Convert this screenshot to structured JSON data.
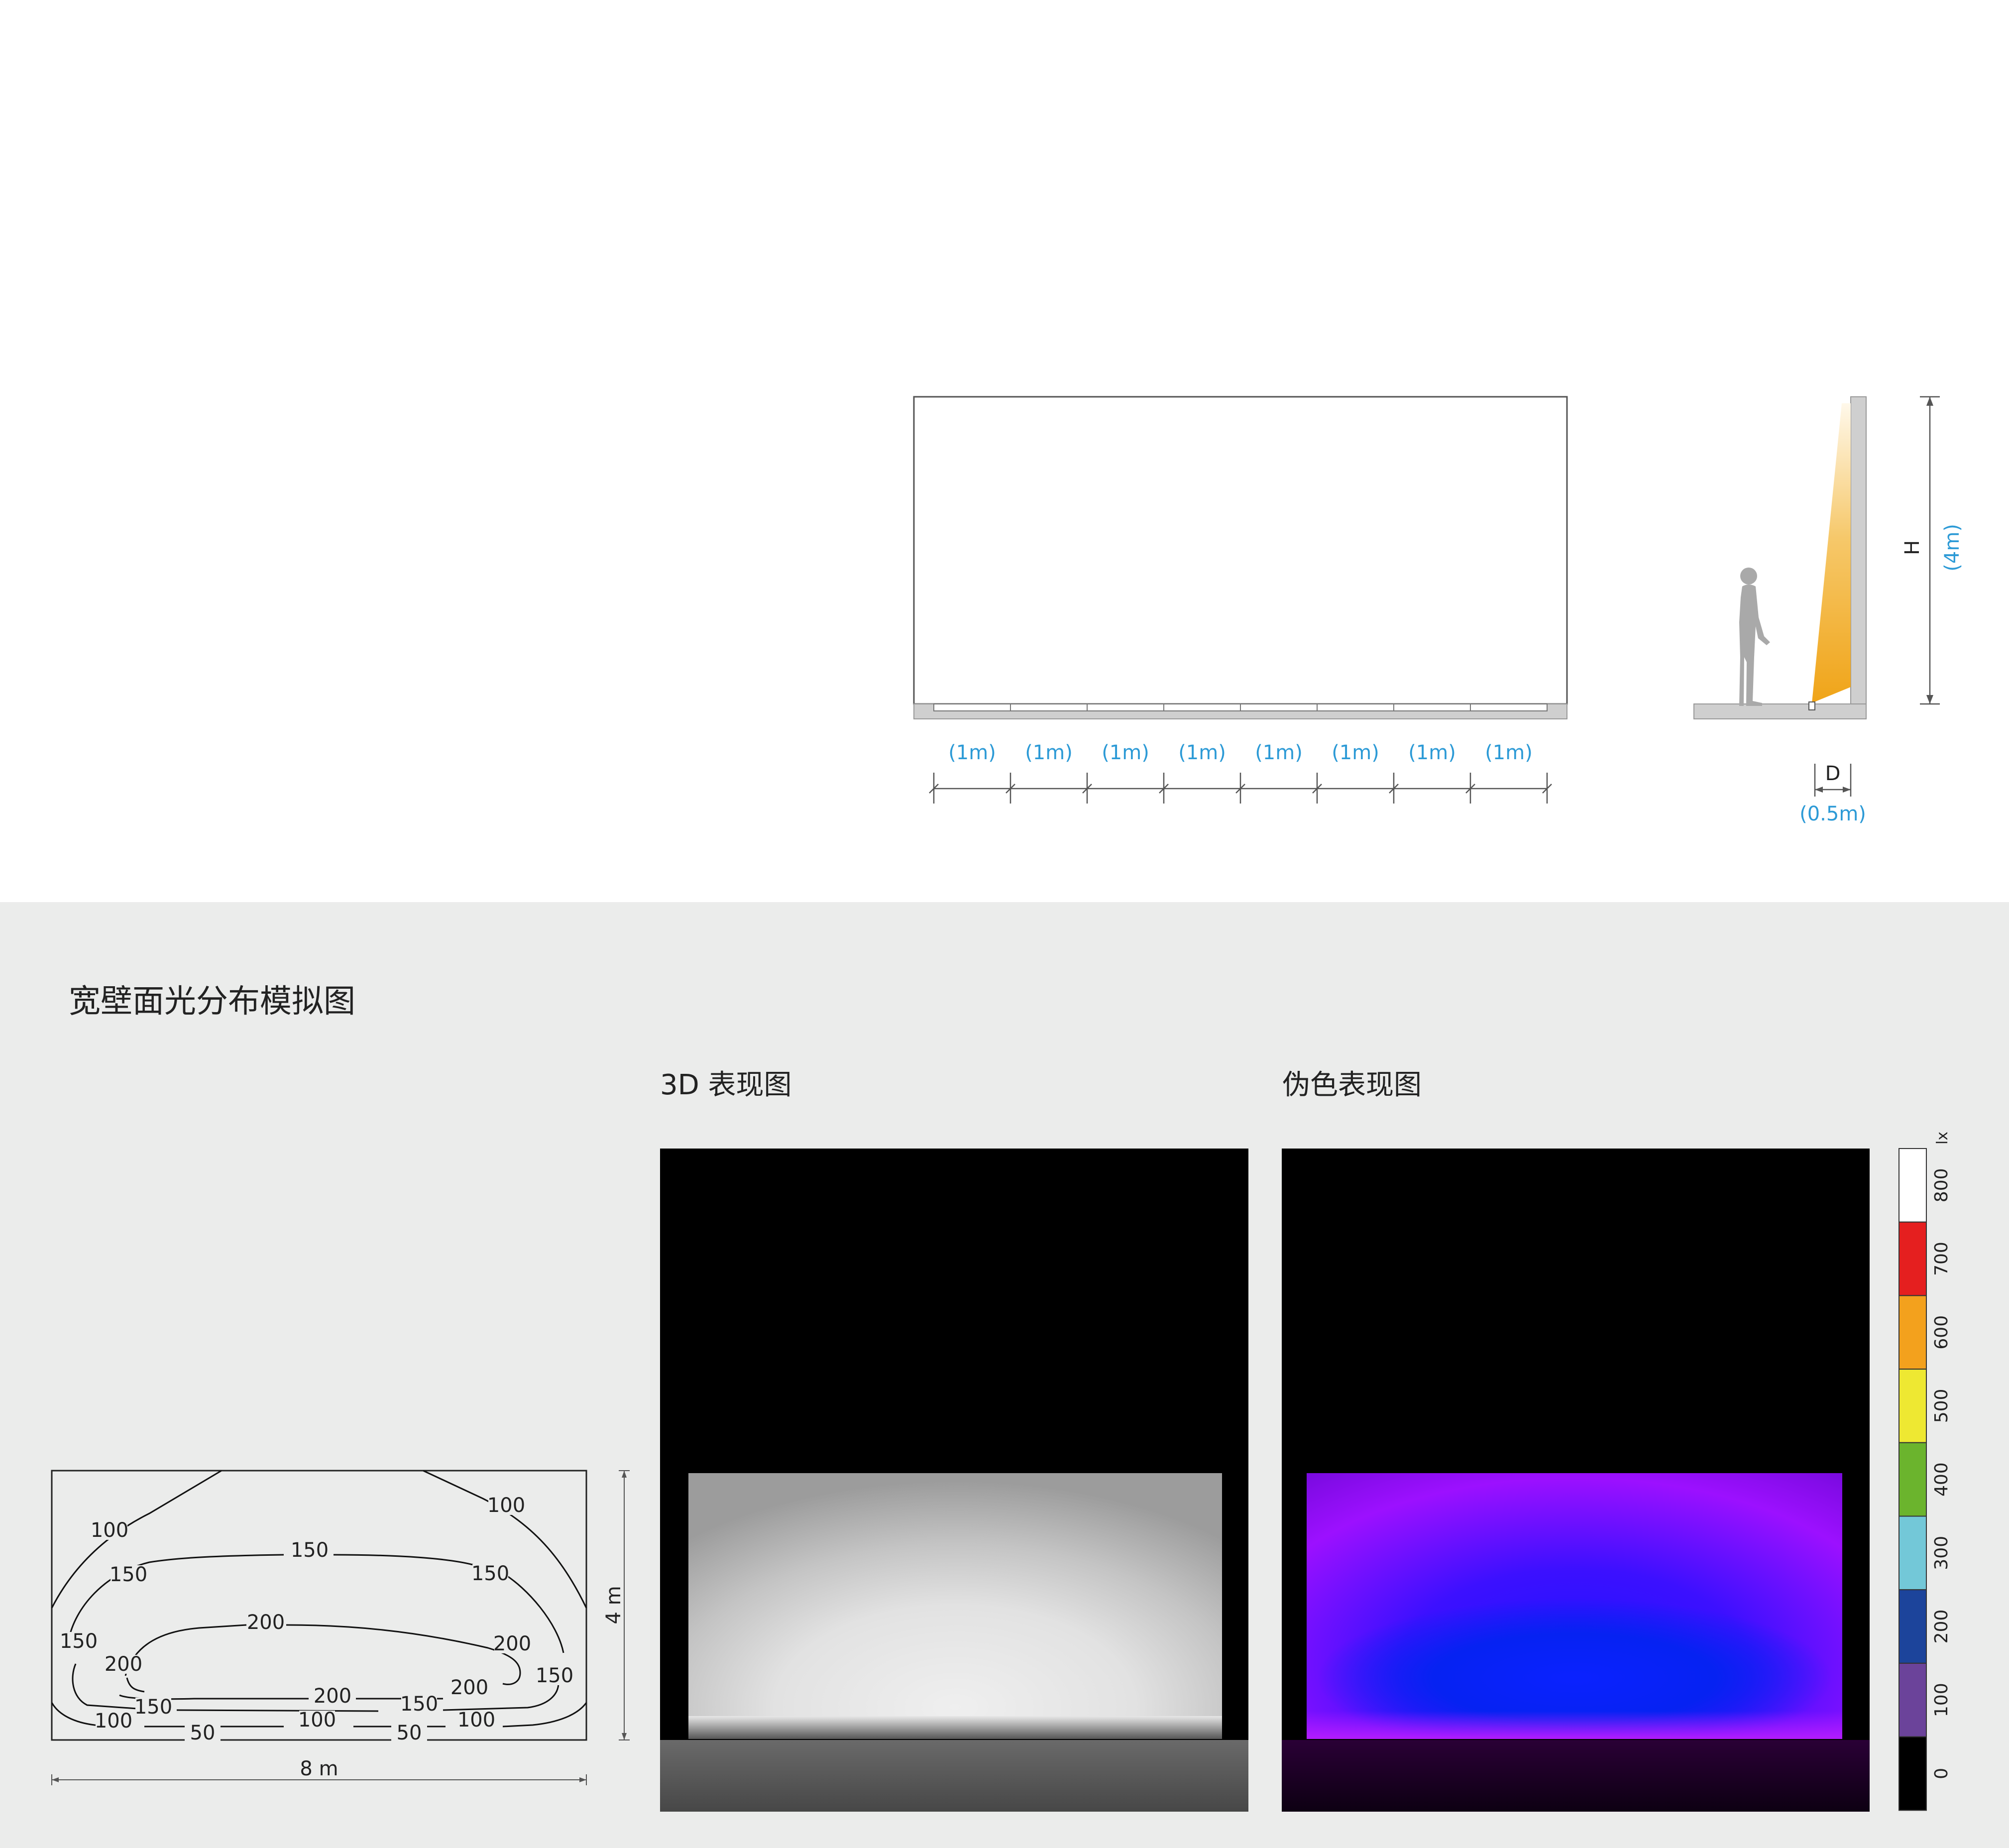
{
  "wall_elevation": {
    "segment_labels": [
      "(1m)",
      "(1m)",
      "(1m)",
      "(1m)",
      "(1m)",
      "(1m)",
      "(1m)",
      "(1m)"
    ]
  },
  "section_view": {
    "height_symbol": "H",
    "height_value": "(4m)",
    "distance_symbol": "D",
    "distance_value": "(0.5m)"
  },
  "simulation": {
    "title": "宽壁面光分布模拟图",
    "render_3d_title": "3D 表现图",
    "false_color_title": "伪色表现图"
  },
  "isolux_plot": {
    "width_label": "8 m",
    "height_label": "4 m",
    "contour_labels": [
      {
        "id": "c100-top-left",
        "text": "100"
      },
      {
        "id": "c100-top-right",
        "text": "100"
      },
      {
        "id": "c150-top",
        "text": "150"
      },
      {
        "id": "c150-left",
        "text": "150"
      },
      {
        "id": "c150-right",
        "text": "150"
      },
      {
        "id": "c150-far-left",
        "text": "150"
      },
      {
        "id": "c200-top",
        "text": "200"
      },
      {
        "id": "c200-right",
        "text": "200"
      },
      {
        "id": "c200-left",
        "text": "200"
      },
      {
        "id": "c150-far-right",
        "text": "150"
      },
      {
        "id": "c200-bottom",
        "text": "200"
      },
      {
        "id": "c200-bottom-right",
        "text": "200"
      },
      {
        "id": "c150-bottom-left",
        "text": "150"
      },
      {
        "id": "c150-bottom-right",
        "text": "150"
      },
      {
        "id": "c100-bottom-left",
        "text": "100"
      },
      {
        "id": "c100-bottom-center",
        "text": "100"
      },
      {
        "id": "c100-bottom-right",
        "text": "100"
      },
      {
        "id": "c50-left",
        "text": "50"
      },
      {
        "id": "c50-right",
        "text": "50"
      }
    ]
  },
  "color_scale": {
    "unit": "lx",
    "stops": [
      {
        "value": "800",
        "color": "#ffffff"
      },
      {
        "value": "700",
        "color": "#e51f1f"
      },
      {
        "value": "600",
        "color": "#f3a11d"
      },
      {
        "value": "500",
        "color": "#eee832"
      },
      {
        "value": "400",
        "color": "#6bb42d"
      },
      {
        "value": "300",
        "color": "#73c8d8"
      },
      {
        "value": "200",
        "color": "#1c449b"
      },
      {
        "value": "100",
        "color": "#6b439a"
      },
      {
        "value": "0",
        "color": "#000000"
      }
    ]
  },
  "colors": {
    "dimension_blue": "#2c9ad6",
    "light_beam": "#f2b430",
    "panel_bg": "#ebeceb"
  }
}
